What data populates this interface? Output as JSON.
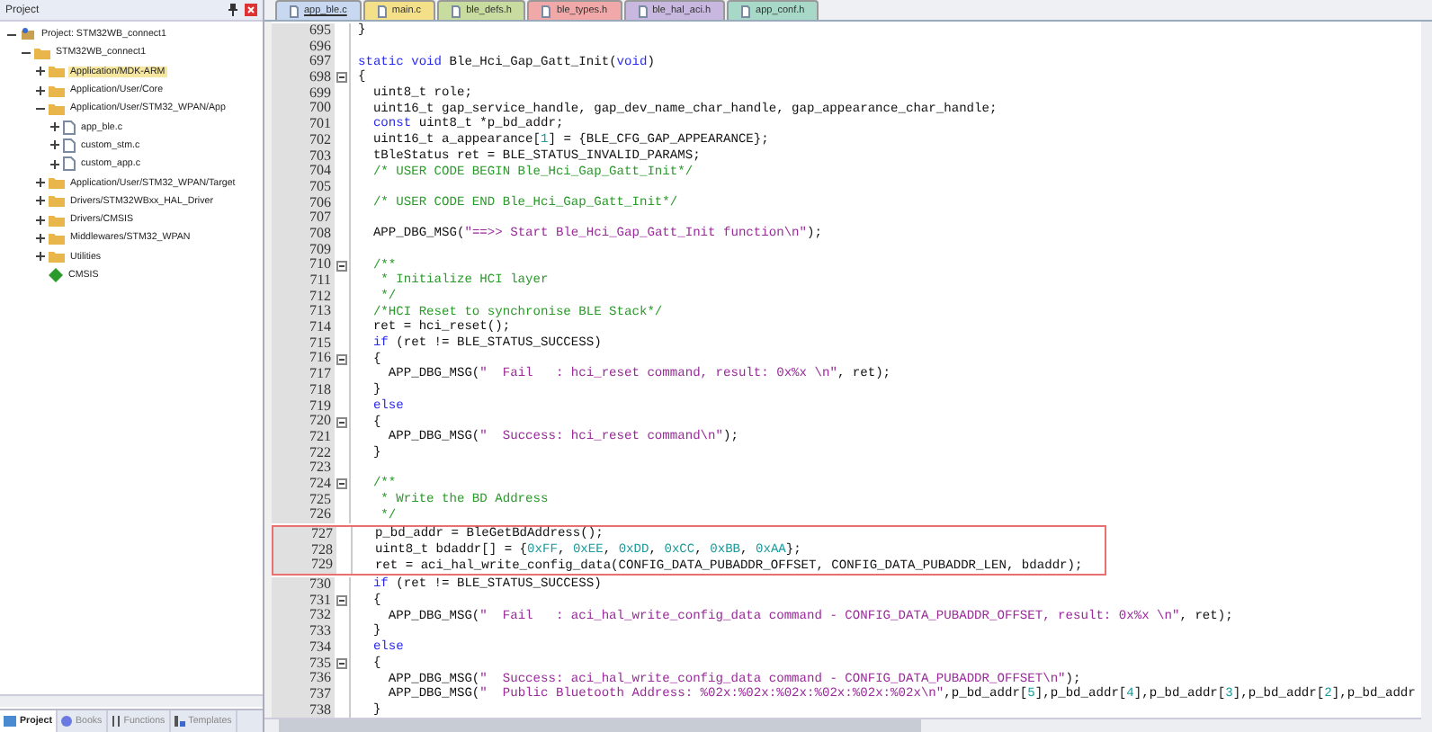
{
  "project": {
    "title": "Project",
    "tree": [
      {
        "label": "Project: STM32WB_connect1",
        "kind": "project",
        "expanded": true,
        "selected": false,
        "children": [
          {
            "label": "STM32WB_connect1",
            "kind": "target",
            "expanded": true,
            "selected": false,
            "children": [
              {
                "label": "Application/MDK-ARM",
                "kind": "folder",
                "expanded": false,
                "selected": true
              },
              {
                "label": "Application/User/Core",
                "kind": "folder",
                "expanded": false,
                "selected": false
              },
              {
                "label": "Application/User/STM32_WPAN/App",
                "kind": "folder",
                "expanded": true,
                "selected": false,
                "children": [
                  {
                    "label": "app_ble.c",
                    "kind": "file",
                    "expanded": false,
                    "selected": false
                  },
                  {
                    "label": "custom_stm.c",
                    "kind": "file",
                    "expanded": false,
                    "selected": false
                  },
                  {
                    "label": "custom_app.c",
                    "kind": "file",
                    "expanded": false,
                    "selected": false
                  }
                ]
              },
              {
                "label": "Application/User/STM32_WPAN/Target",
                "kind": "folder",
                "expanded": false,
                "selected": false
              },
              {
                "label": "Drivers/STM32WBxx_HAL_Driver",
                "kind": "folder",
                "expanded": false,
                "selected": false
              },
              {
                "label": "Drivers/CMSIS",
                "kind": "folder",
                "expanded": false,
                "selected": false
              },
              {
                "label": "Middlewares/STM32_WPAN",
                "kind": "folder",
                "expanded": false,
                "selected": false
              },
              {
                "label": "Utilities",
                "kind": "folder",
                "expanded": false,
                "selected": false
              },
              {
                "label": "CMSIS",
                "kind": "component",
                "selected": false
              }
            ]
          }
        ]
      }
    ],
    "tabs": [
      {
        "label": "Project",
        "kind": "project",
        "selected": true
      },
      {
        "label": "Books",
        "kind": "books",
        "selected": false
      },
      {
        "label": "Functions",
        "kind": "functions",
        "selected": false
      },
      {
        "label": "Templates",
        "kind": "templates",
        "selected": false
      }
    ]
  },
  "editor": {
    "tabs": [
      {
        "label": "app_ble.c",
        "color": "#c8d8f0",
        "selected": true
      },
      {
        "label": "main.c",
        "color": "#f5e08a",
        "selected": false
      },
      {
        "label": "ble_defs.h",
        "color": "#c8dca0",
        "selected": false
      },
      {
        "label": "ble_types.h",
        "color": "#f0a8a8",
        "selected": false
      },
      {
        "label": "ble_hal_aci.h",
        "color": "#c8b8e0",
        "selected": false
      },
      {
        "label": "app_conf.h",
        "color": "#a8d8c8",
        "selected": false
      }
    ],
    "blocks": [
      {
        "boxed": false,
        "lines": [
          {
            "number": "695",
            "segments": [
              {
                "kind": "plain",
                "text": "}"
              }
            ]
          },
          {
            "number": "696"
          },
          {
            "number": "697",
            "segments": [
              {
                "kind": "keyword",
                "text": "static void"
              },
              {
                "kind": "plain",
                "text": " Ble_Hci_Gap_Gatt_Init("
              },
              {
                "kind": "keyword",
                "text": "void"
              },
              {
                "kind": "plain",
                "text": ")"
              }
            ]
          },
          {
            "number": "698",
            "fold": true,
            "segments": [
              {
                "kind": "plain",
                "text": "{"
              }
            ]
          },
          {
            "number": "699",
            "segments": [
              {
                "kind": "plain",
                "text": "  uint8_t role;"
              }
            ]
          },
          {
            "number": "700",
            "segments": [
              {
                "kind": "plain",
                "text": "  uint16_t gap_service_handle, gap_dev_name_char_handle, gap_appearance_char_handle;"
              }
            ]
          },
          {
            "number": "701",
            "segments": [
              {
                "kind": "keyword",
                "text": "  const"
              },
              {
                "kind": "plain",
                "text": " uint8_t *p_bd_addr;"
              }
            ]
          },
          {
            "number": "702",
            "segments": [
              {
                "kind": "plain",
                "text": "  uint16_t a_appearance["
              },
              {
                "kind": "number",
                "text": "1"
              },
              {
                "kind": "plain",
                "text": "] = {BLE_CFG_GAP_APPEARANCE};"
              }
            ]
          },
          {
            "number": "703",
            "segments": [
              {
                "kind": "plain",
                "text": "  tBleStatus ret = BLE_STATUS_INVALID_PARAMS;"
              }
            ]
          },
          {
            "number": "704",
            "segments": [
              {
                "kind": "comment",
                "text": "  /* USER CODE BEGIN Ble_Hci_Gap_Gatt_Init*/"
              }
            ]
          },
          {
            "number": "705"
          },
          {
            "number": "706",
            "segments": [
              {
                "kind": "comment",
                "text": "  /* USER CODE END Ble_Hci_Gap_Gatt_Init*/"
              }
            ]
          },
          {
            "number": "707"
          },
          {
            "number": "708",
            "segments": [
              {
                "kind": "plain",
                "text": "  APP_DBG_MSG("
              },
              {
                "kind": "string",
                "text": "\"==>> Start Ble_Hci_Gap_Gatt_Init function\\n\""
              },
              {
                "kind": "plain",
                "text": ");"
              }
            ]
          },
          {
            "number": "709"
          },
          {
            "number": "710",
            "fold": true,
            "segments": [
              {
                "kind": "comment",
                "text": "  /**"
              }
            ]
          },
          {
            "number": "711",
            "segments": [
              {
                "kind": "comment",
                "text": "   * Initialize HCI layer"
              }
            ]
          },
          {
            "number": "712",
            "segments": [
              {
                "kind": "comment",
                "text": "   */"
              }
            ]
          },
          {
            "number": "713",
            "segments": [
              {
                "kind": "comment",
                "text": "  /*HCI Reset to synchronise BLE Stack*/"
              }
            ]
          },
          {
            "number": "714",
            "segments": [
              {
                "kind": "plain",
                "text": "  ret = hci_reset();"
              }
            ]
          },
          {
            "number": "715",
            "segments": [
              {
                "kind": "keyword",
                "text": "  if"
              },
              {
                "kind": "plain",
                "text": " (ret != BLE_STATUS_SUCCESS)"
              }
            ]
          },
          {
            "number": "716",
            "fold": true,
            "segments": [
              {
                "kind": "plain",
                "text": "  {"
              }
            ]
          },
          {
            "number": "717",
            "segments": [
              {
                "kind": "plain",
                "text": "    APP_DBG_MSG("
              },
              {
                "kind": "string",
                "text": "\"  Fail   : hci_reset command, result: 0x%x \\n\""
              },
              {
                "kind": "plain",
                "text": ", ret);"
              }
            ]
          },
          {
            "number": "718",
            "segments": [
              {
                "kind": "plain",
                "text": "  }"
              }
            ]
          },
          {
            "number": "719",
            "segments": [
              {
                "kind": "keyword",
                "text": "  else"
              }
            ]
          },
          {
            "number": "720",
            "fold": true,
            "segments": [
              {
                "kind": "plain",
                "text": "  {"
              }
            ]
          },
          {
            "number": "721",
            "segments": [
              {
                "kind": "plain",
                "text": "    APP_DBG_MSG("
              },
              {
                "kind": "string",
                "text": "\"  Success: hci_reset command\\n\""
              },
              {
                "kind": "plain",
                "text": ");"
              }
            ]
          },
          {
            "number": "722",
            "segments": [
              {
                "kind": "plain",
                "text": "  }"
              }
            ]
          },
          {
            "number": "723"
          },
          {
            "number": "724",
            "fold": true,
            "segments": [
              {
                "kind": "comment",
                "text": "  /**"
              }
            ]
          },
          {
            "number": "725",
            "segments": [
              {
                "kind": "comment",
                "text": "   * Write the BD Address"
              }
            ]
          },
          {
            "number": "726",
            "segments": [
              {
                "kind": "comment",
                "text": "   */"
              }
            ]
          }
        ]
      },
      {
        "boxed": true,
        "lines": [
          {
            "number": "727",
            "segments": [
              {
                "kind": "plain",
                "text": "  p_bd_addr = BleGetBdAddress();"
              }
            ]
          },
          {
            "number": "728",
            "segments": [
              {
                "kind": "plain",
                "text": "  uint8_t bdaddr[] = {"
              },
              {
                "kind": "number",
                "text": "0xFF"
              },
              {
                "kind": "plain",
                "text": ", "
              },
              {
                "kind": "number",
                "text": "0xEE"
              },
              {
                "kind": "plain",
                "text": ", "
              },
              {
                "kind": "number",
                "text": "0xDD"
              },
              {
                "kind": "plain",
                "text": ", "
              },
              {
                "kind": "number",
                "text": "0xCC"
              },
              {
                "kind": "plain",
                "text": ", "
              },
              {
                "kind": "number",
                "text": "0xBB"
              },
              {
                "kind": "plain",
                "text": ", "
              },
              {
                "kind": "number",
                "text": "0xAA"
              },
              {
                "kind": "plain",
                "text": "};"
              }
            ]
          },
          {
            "number": "729",
            "segments": [
              {
                "kind": "plain",
                "text": "  ret = aci_hal_write_config_data(CONFIG_DATA_PUBADDR_OFFSET, CONFIG_DATA_PUBADDR_LEN, bdaddr);"
              }
            ]
          }
        ]
      },
      {
        "boxed": false,
        "lines": [
          {
            "number": "730",
            "segments": [
              {
                "kind": "keyword",
                "text": "  if"
              },
              {
                "kind": "plain",
                "text": " (ret != BLE_STATUS_SUCCESS)"
              }
            ]
          },
          {
            "number": "731",
            "fold": true,
            "segments": [
              {
                "kind": "plain",
                "text": "  {"
              }
            ]
          },
          {
            "number": "732",
            "segments": [
              {
                "kind": "plain",
                "text": "    APP_DBG_MSG("
              },
              {
                "kind": "string",
                "text": "\"  Fail   : aci_hal_write_config_data command - CONFIG_DATA_PUBADDR_OFFSET, result: 0x%x \\n\""
              },
              {
                "kind": "plain",
                "text": ", ret);"
              }
            ]
          },
          {
            "number": "733",
            "segments": [
              {
                "kind": "plain",
                "text": "  }"
              }
            ]
          },
          {
            "number": "734",
            "segments": [
              {
                "kind": "keyword",
                "text": "  else"
              }
            ]
          },
          {
            "number": "735",
            "fold": true,
            "segments": [
              {
                "kind": "plain",
                "text": "  {"
              }
            ]
          },
          {
            "number": "736",
            "segments": [
              {
                "kind": "plain",
                "text": "    APP_DBG_MSG("
              },
              {
                "kind": "string",
                "text": "\"  Success: aci_hal_write_config_data command - CONFIG_DATA_PUBADDR_OFFSET\\n\""
              },
              {
                "kind": "plain",
                "text": ");"
              }
            ]
          },
          {
            "number": "737",
            "segments": [
              {
                "kind": "plain",
                "text": "    APP_DBG_MSG("
              },
              {
                "kind": "string",
                "text": "\"  Public Bluetooth Address: %02x:%02x:%02x:%02x:%02x:%02x\\n\""
              },
              {
                "kind": "plain",
                "text": ",p_bd_addr["
              },
              {
                "kind": "number",
                "text": "5"
              },
              {
                "kind": "plain",
                "text": "],p_bd_addr["
              },
              {
                "kind": "number",
                "text": "4"
              },
              {
                "kind": "plain",
                "text": "],p_bd_addr["
              },
              {
                "kind": "number",
                "text": "3"
              },
              {
                "kind": "plain",
                "text": "],p_bd_addr["
              },
              {
                "kind": "number",
                "text": "2"
              },
              {
                "kind": "plain",
                "text": "],p_bd_addr"
              }
            ]
          },
          {
            "number": "738",
            "segments": [
              {
                "kind": "plain",
                "text": "  }"
              }
            ]
          }
        ]
      }
    ]
  }
}
